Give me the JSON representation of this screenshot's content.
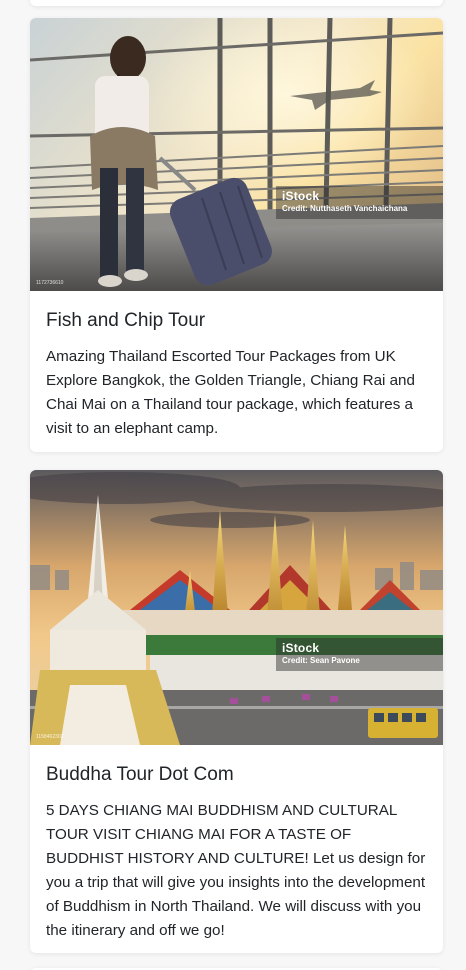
{
  "cards": [
    {
      "title": "Fish and Chip Tour",
      "text": "Amazing Thailand Escorted Tour Packages from UK Explore Bangkok, the Golden Triangle, Chiang Rai and Chai Mai on a Thailand tour package, which features a visit to an elephant camp.",
      "image": {
        "description": "traveller-with-suitcase-at-airport",
        "stock_brand": "iStock",
        "stock_credit": "Credit: Nutthaseth Vanchaichana",
        "stock_id": "1172736610"
      }
    },
    {
      "title": "Buddha Tour Dot Com",
      "text": "5 DAYS CHIANG MAI BUDDHISM AND CULTURAL TOUR VISIT CHIANG MAI FOR A TASTE OF BUDDHIST HISTORY AND CULTURE! Let us design for you a trip that will give you insights into the development of Buddhism in North Thailand. We will discuss with you the itinerary and off we go!",
      "image": {
        "description": "bangkok-grand-palace-temple",
        "stock_brand": "iStock",
        "stock_credit": "Credit: Sean Pavone",
        "stock_id": "1158462303"
      }
    }
  ],
  "colors": {
    "page_background": "#f7f7f8",
    "card_background": "#ffffff",
    "text": "#212529"
  }
}
